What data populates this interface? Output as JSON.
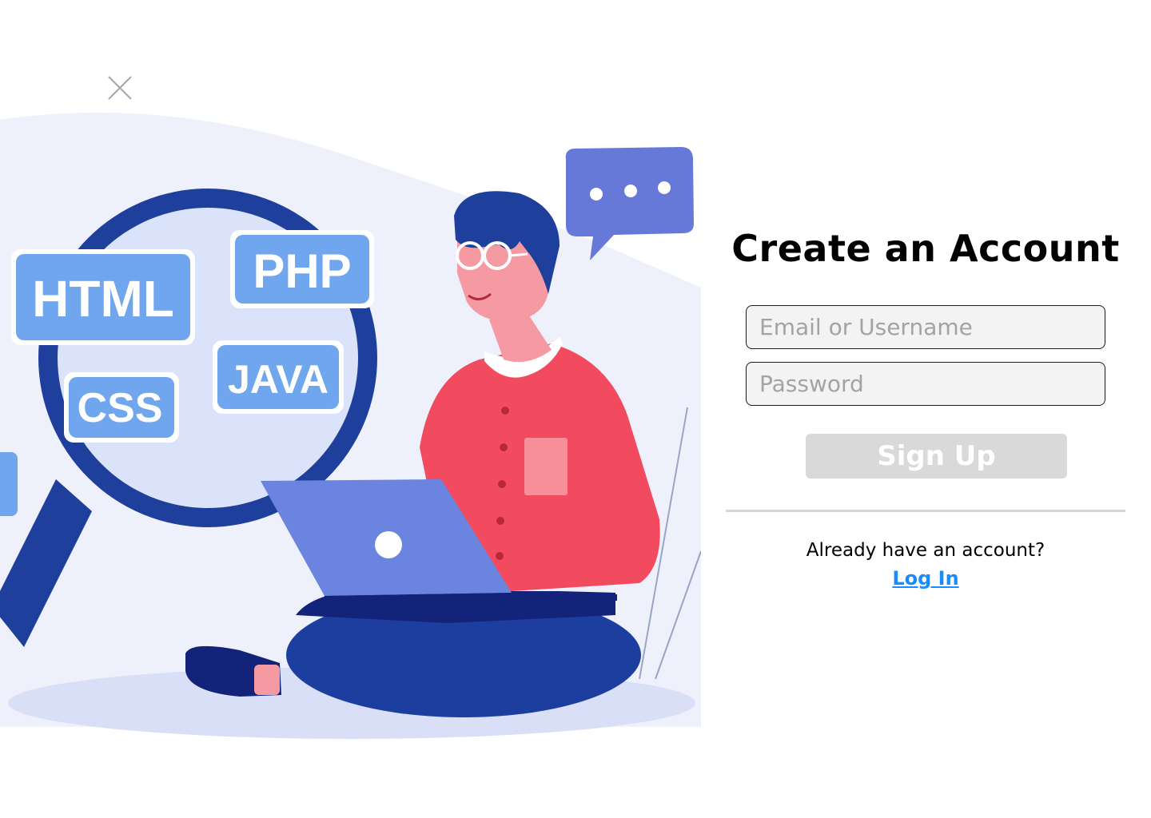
{
  "close": {
    "icon": "close-icon"
  },
  "illustration": {
    "tags": {
      "html": "HTML",
      "php": "PHP",
      "java": "JAVA",
      "css": "CSS"
    },
    "colors": {
      "tag_fill": "#6fa6ee",
      "lens_ring": "#1f3f9c",
      "shirt": "#f24b5f",
      "pants": "#1c3f9f",
      "laptop": "#6b84e0",
      "bubble": "#6678d8"
    }
  },
  "form": {
    "title": "Create an Account",
    "email_placeholder": "Email or Username",
    "password_placeholder": "Password",
    "signup_label": "Sign Up",
    "already_text": "Already have an account?",
    "login_label": "Log In"
  },
  "colors": {
    "link": "#1a8cff",
    "button_disabled": "#d9d9d9",
    "field_bg": "#f3f3f3"
  }
}
